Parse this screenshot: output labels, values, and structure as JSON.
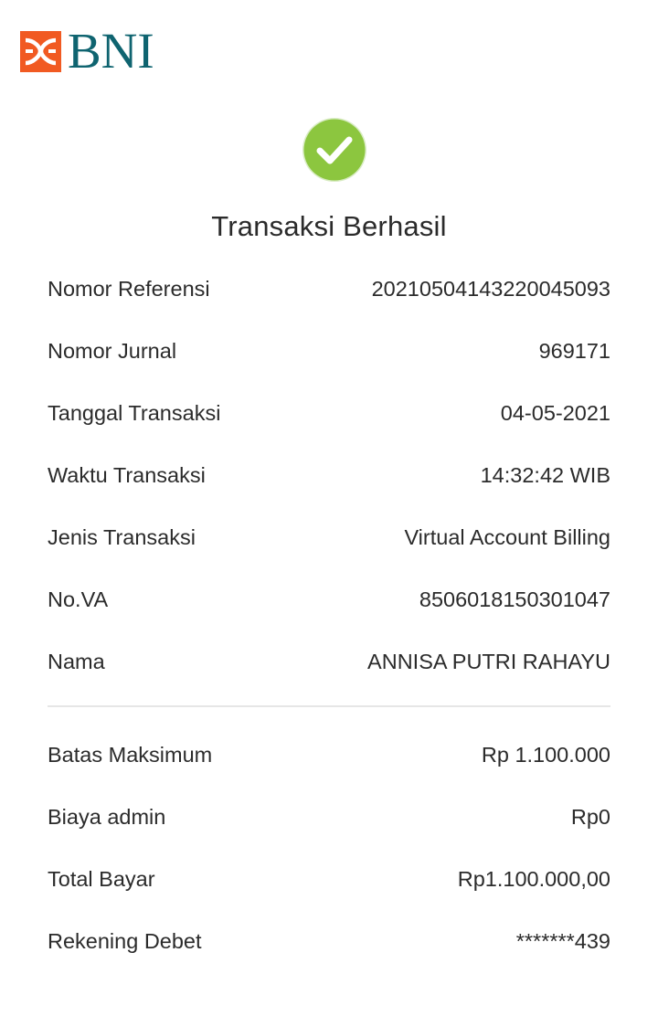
{
  "logo": {
    "text": "BNI",
    "mark_color": "#f15a22",
    "text_color": "#0f6470"
  },
  "status": {
    "icon": "check-circle-icon",
    "icon_color": "#8cc63f",
    "title": "Transaksi Berhasil"
  },
  "details": [
    {
      "label": "Nomor Referensi",
      "value": "20210504143220045093"
    },
    {
      "label": "Nomor Jurnal",
      "value": "969171"
    },
    {
      "label": "Tanggal Transaksi",
      "value": "04-05-2021"
    },
    {
      "label": "Waktu Transaksi",
      "value": "14:32:42 WIB"
    },
    {
      "label": "Jenis Transaksi",
      "value": "Virtual Account Billing"
    },
    {
      "label": "No.VA",
      "value": "8506018150301047"
    },
    {
      "label": "Nama",
      "value": "ANNISA PUTRI RAHAYU"
    }
  ],
  "payment": [
    {
      "label": "Batas Maksimum",
      "value": "Rp 1.100.000"
    },
    {
      "label": "Biaya admin",
      "value": "Rp0"
    },
    {
      "label": "Total Bayar",
      "value": "Rp1.100.000,00"
    },
    {
      "label": "Rekening Debet",
      "value": "*******439"
    }
  ]
}
